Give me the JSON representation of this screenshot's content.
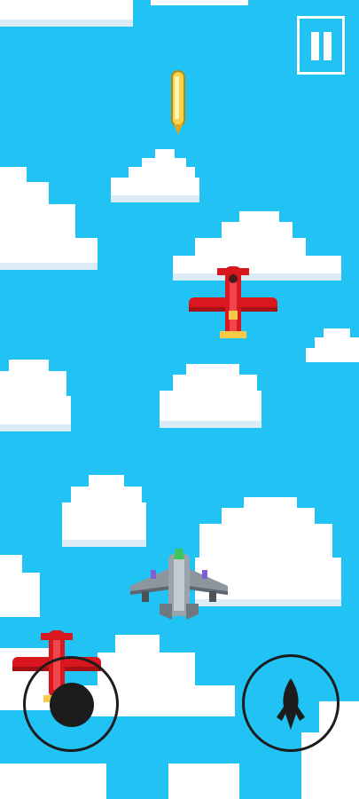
{
  "game": {
    "sky_color": "#21c3f4",
    "cloud_color": "#ffffff",
    "cloud_shadow_color": "#dcecf7",
    "enemy_color": "#d9171e",
    "player_color": "#7d8690",
    "bullet_color": "#f7d24b"
  },
  "hud": {
    "pause_icon": "pause-icon",
    "joystick_icon": "joystick-thumb",
    "fire_icon": "rocket-icon"
  }
}
